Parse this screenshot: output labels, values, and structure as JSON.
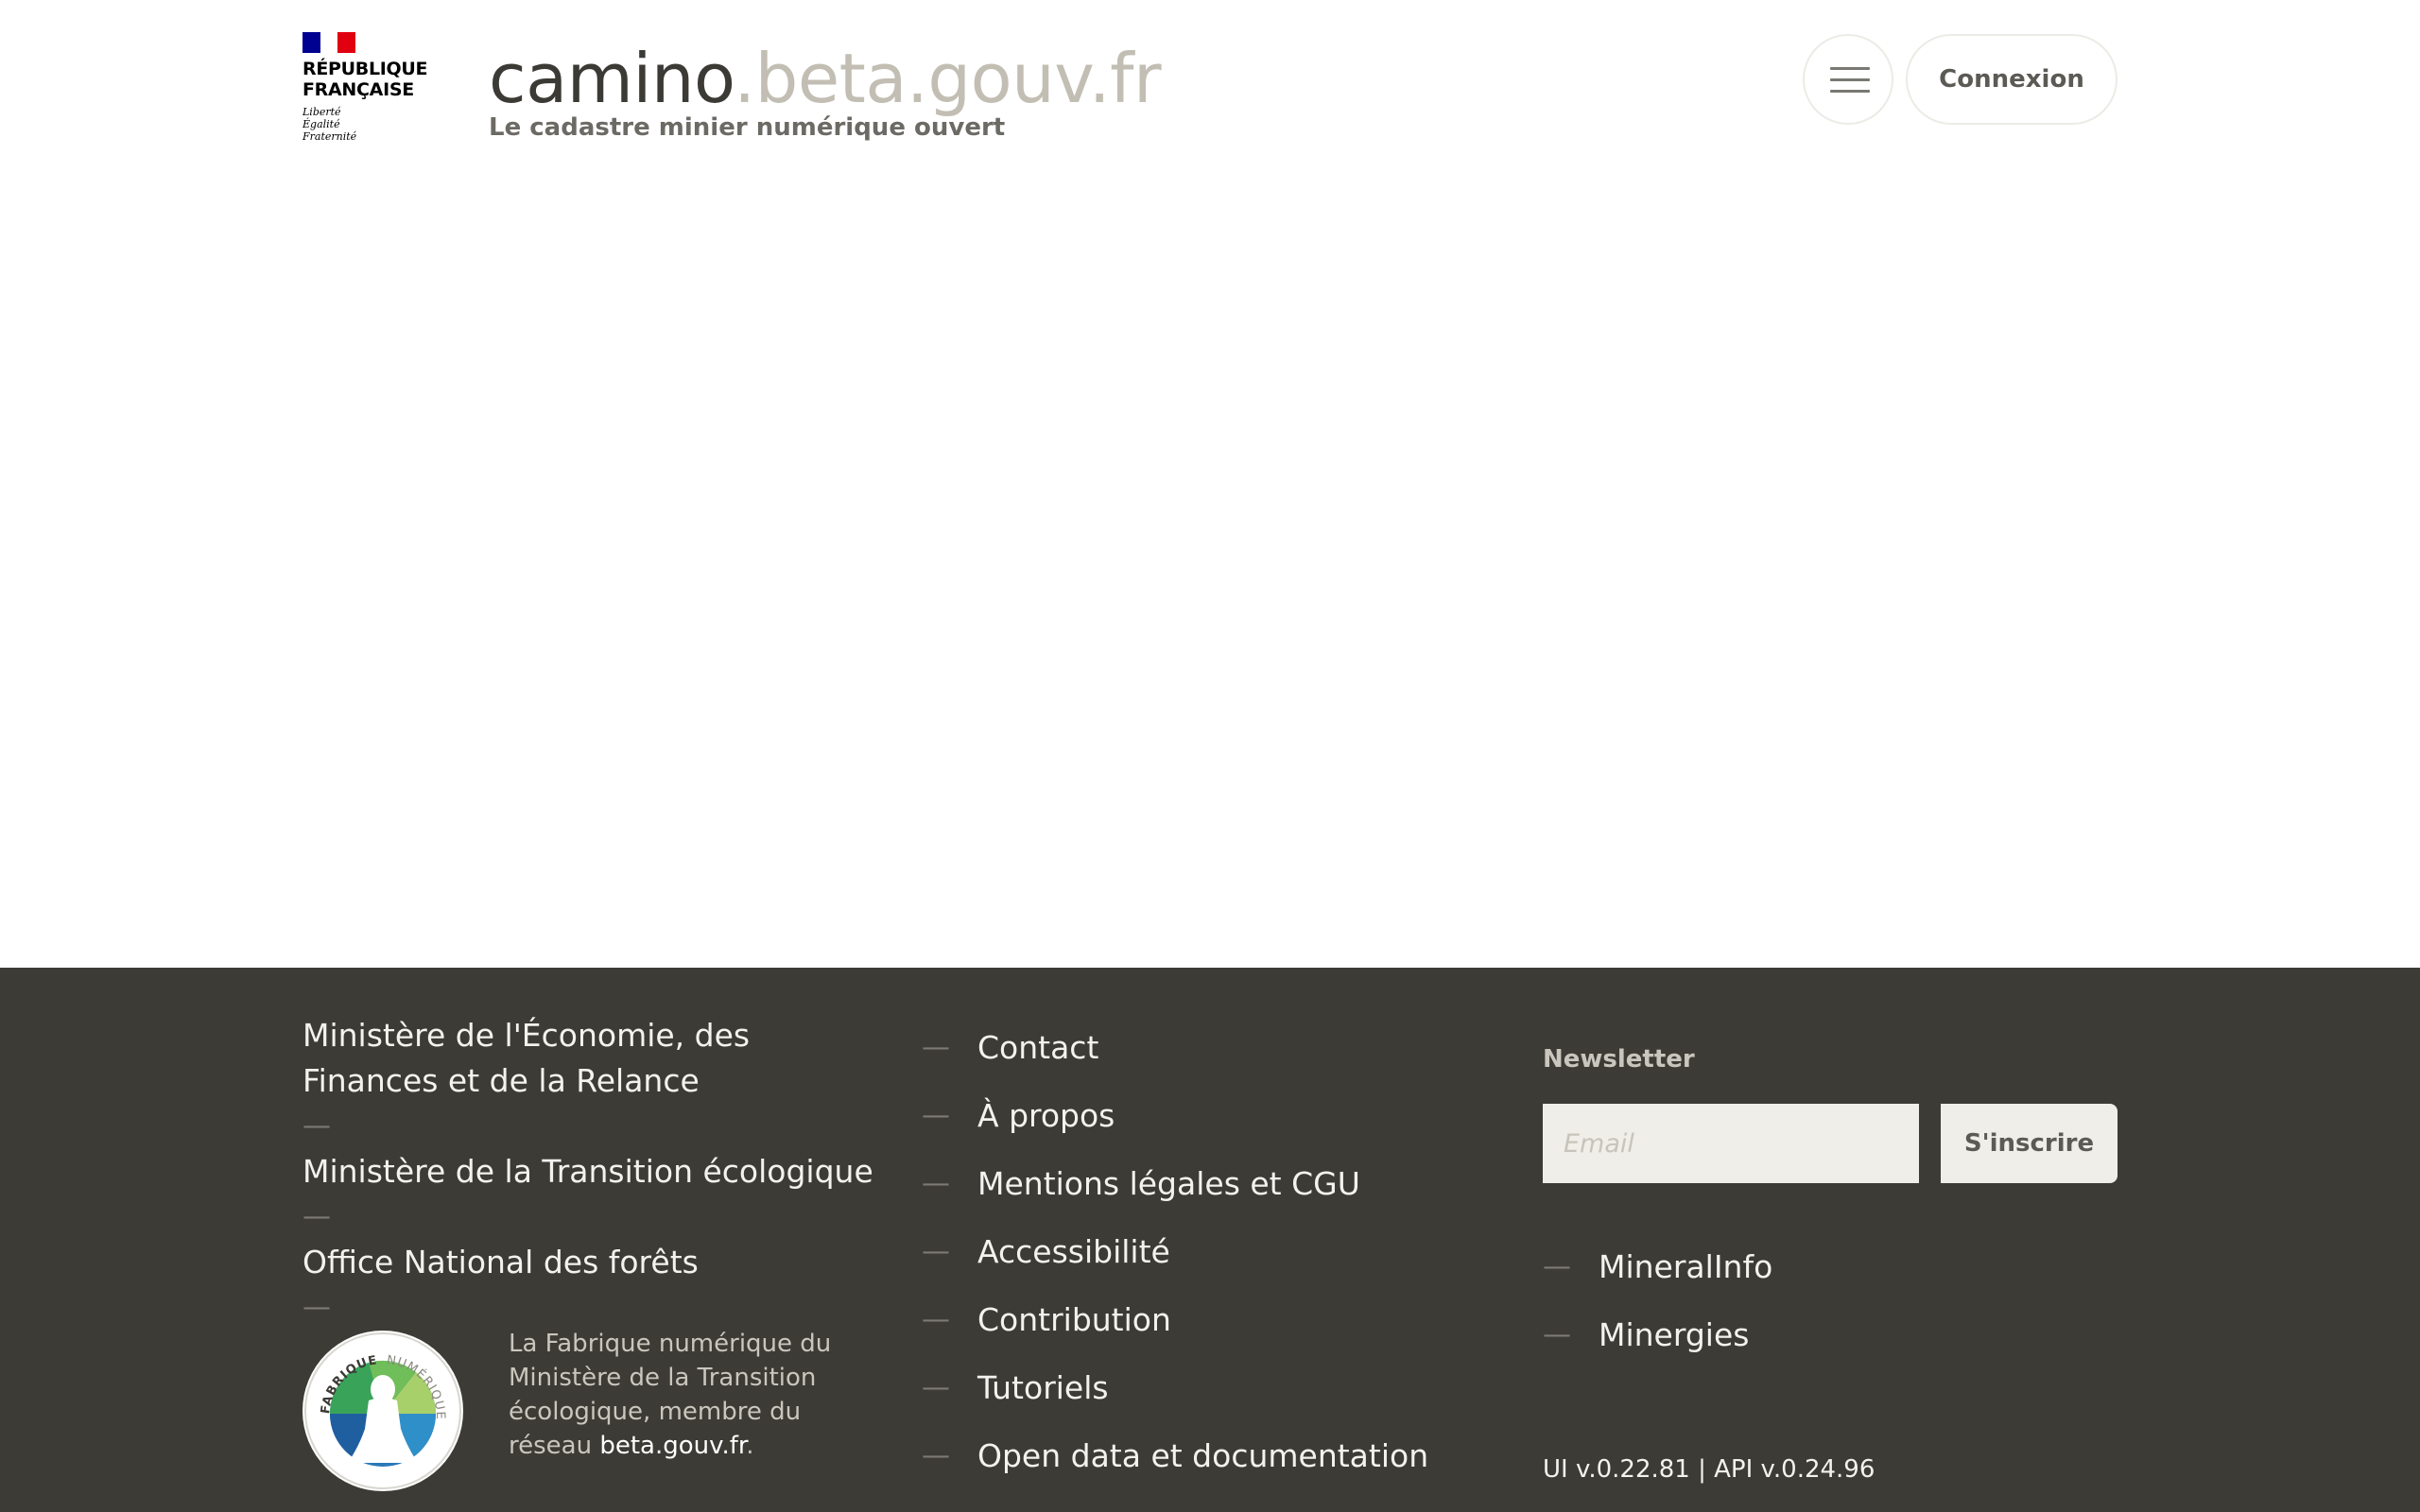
{
  "header": {
    "rf_name_line1": "RÉPUBLIQUE",
    "rf_name_line2": "FRANÇAISE",
    "rf_motto_1": "Liberté",
    "rf_motto_2": "Égalité",
    "rf_motto_3": "Fraternité",
    "title_main": "camino",
    "title_domain": ".beta.gouv.fr",
    "subtitle": "Le cadastre minier numérique ouvert",
    "menu_icon": "hamburger-menu-icon",
    "login_label": "Connexion"
  },
  "footer": {
    "ministries": [
      "Ministère de l'Économie, des Finances et de la Relance",
      "Ministère de la Transition écologique",
      "Office National des forêts"
    ],
    "separator": "—",
    "fabrique_logo_text_top": "FABRIQUE",
    "fabrique_logo_text_right": "NUMÉRIQUE",
    "fabrique_text": "La Fabrique numérique du Ministère de la Transition écologique, membre du réseau ",
    "fabrique_link": "beta.gouv.fr",
    "fabrique_text_end": ".",
    "links": [
      "Contact",
      "À propos",
      "Mentions légales et CGU",
      "Accessibilité",
      "Contribution",
      "Tutoriels",
      "Open data et documentation"
    ],
    "newsletter": {
      "title": "Newsletter",
      "placeholder": "Email",
      "value": "",
      "button_label": "S'inscrire"
    },
    "external_links": [
      "MineralInfo",
      "Minergies"
    ],
    "version": "UI v.0.22.81 | API v.0.24.96"
  },
  "colors": {
    "footer_bg": "#3c3b35",
    "title_dark": "#3c3a35",
    "title_light": "#c2beb3",
    "flag_blue": "#000091",
    "flag_white": "#ffffff",
    "flag_red": "#e1000f"
  }
}
